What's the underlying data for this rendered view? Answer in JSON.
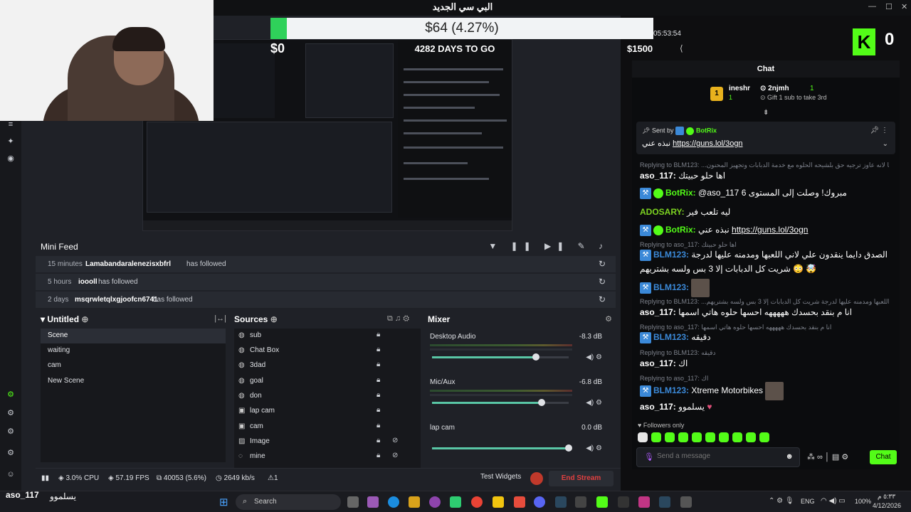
{
  "window": {
    "title": "البي سي الجديد"
  },
  "goal": {
    "text": "$64 (4.27%)",
    "progress": 0.0427
  },
  "overlay": {
    "amount_left": "$0",
    "stream_timer": "05:53:54",
    "amount_right": "$1500",
    "kick_count": "0"
  },
  "preview": {
    "days_text": "4282 DAYS TO GO"
  },
  "mini_feed": {
    "title": "Mini Feed",
    "rows": [
      {
        "time": "15 minutes",
        "user": "Lamabandaralenezisxbfrl",
        "action": "has followed"
      },
      {
        "time": "5 hours",
        "user": "ioooll",
        "action": "has followed"
      },
      {
        "time": "2 days",
        "user": "msqrwletqlxgjoofcn6741",
        "action": "has followed"
      }
    ]
  },
  "scenes": {
    "title": "Untitled",
    "items": [
      "Scene",
      "waiting",
      "cam",
      "New Scene"
    ]
  },
  "sources": {
    "title": "Sources",
    "items": [
      "sub",
      "Chat Box",
      "3dad",
      "goal",
      "don",
      "lap cam",
      "cam",
      "Image",
      "mine"
    ]
  },
  "mixer": {
    "title": "Mixer",
    "channels": [
      {
        "name": "Desktop Audio",
        "db": "-8.3 dB",
        "level": 0.76
      },
      {
        "name": "Mic/Aux",
        "db": "-6.8 dB",
        "level": 0.8
      },
      {
        "name": "lap cam",
        "db": "0.0 dB",
        "level": 1.0
      }
    ]
  },
  "status": {
    "cpu": "3.0% CPU",
    "fps": "57.19 FPS",
    "frames": "40053 (5.6%)",
    "bitrate": "2649 kb/s",
    "alerts": "1",
    "test_widgets": "Test Widgets",
    "end_stream": "End Stream"
  },
  "chat": {
    "title": "Chat",
    "leaderboard": {
      "user1": "ineshr",
      "count1": "1",
      "user2": "2njmh",
      "count2": "1",
      "gift_text": "Gift 1 sub to take 3rd"
    },
    "pinned": {
      "sent_by": "Sent by",
      "author": "BotRix",
      "text": "نبذه عني",
      "link": "https://guns.lol/3ogn"
    },
    "messages": {
      "r1": "Replying to BLM123: ...يا الشخص علينا لانه عاوز ترجيه حق بلشيحه الحلوه مع خدمة الدبابات وتجهيز المحنون",
      "m1_user": "aso_117:",
      "m1_text": "اها حلو حبيتك",
      "m2_user": "BotRix:",
      "m2_text": "@aso_117 مبروك! وصلت إلى المستوى 6",
      "m3_user": "ADOSARY:",
      "m3_text": "ليه تلعب فير",
      "m4_user": "BotRix:",
      "m4_text": "نبذه عني",
      "m4_link": "https://guns.lol/3ogn",
      "r2": "Replying to aso_117: اها حلو حبيتك",
      "m5_user": "BLM123:",
      "m5_text": "والله الصدق دايما ينقدون علي لاني اللعبها ومدمنه عليها لدرجة",
      "m5_text2": "شريت كل الدبابات إلا 3 بس ولسه بشتريهم",
      "m6_user": "BLM123:",
      "r3": "Replying to BLM123: ...دايما ينقدون علي لاني اللعبها ومدمنه عليها لدرجة شريت كل الدبابات إلا 3 بس ولسه بشتريهم",
      "m7_user": "aso_117:",
      "m7_text": "انا م بنقد بحسدك هههههه احسها حلوه هاتي اسمها",
      "r4": "Replying to aso_117: انا م بنقد بحسدك هههههه احسها حلوه هاتي اسمها",
      "m8_user": "BLM123:",
      "m8_text": "دقيقه",
      "r5": "Replying to BLM123: دقيقه",
      "m9_user": "aso_117:",
      "m9_text": "اك",
      "r6": "Replying to aso_117: اك",
      "m10_user": "BLM123:",
      "m10_text": "Xtreme Motorbikes",
      "m11_user": "aso_117:",
      "m11_text": "يسلموو"
    },
    "followers_only": "Followers only",
    "input_placeholder": "Send a message",
    "send_label": "Chat"
  },
  "taskbar": {
    "search": "Search",
    "lang": "ENG",
    "battery": "100%",
    "time": "٥:٣٣ م",
    "date": "4/12/2026",
    "overlay_user": "aso_117",
    "overlay_text": "يسلموو"
  }
}
